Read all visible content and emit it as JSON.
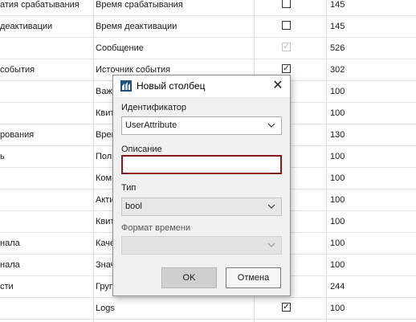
{
  "table": {
    "rows": [
      {
        "c0": "атия срабатывания",
        "c1": "Время срабатывания",
        "check": "unchecked",
        "c3": "145"
      },
      {
        "c0": "деактивации",
        "c1": "Время деактивации",
        "check": "unchecked",
        "c3": "145"
      },
      {
        "c0": "",
        "c1": "Сообщение",
        "check": "checked-disabled",
        "c3": "526"
      },
      {
        "c0": "события",
        "c1": "Источник события",
        "check": "checked",
        "c3": "302"
      },
      {
        "c0": "",
        "c1": "Важ",
        "check": "unchecked",
        "c3": "100"
      },
      {
        "c0": "",
        "c1": "Квит",
        "check": "unchecked",
        "c3": "100"
      },
      {
        "c0": "рования",
        "c1": "Врем",
        "check": "unchecked",
        "c3": "130"
      },
      {
        "c0": "ь",
        "c1": "Поль",
        "check": "unchecked",
        "c3": "100"
      },
      {
        "c0": "",
        "c1": "Комм",
        "check": "unchecked",
        "c3": "100"
      },
      {
        "c0": "",
        "c1": "Акти",
        "check": "unchecked",
        "c3": "100"
      },
      {
        "c0": "",
        "c1": "Квит",
        "check": "unchecked",
        "c3": "100"
      },
      {
        "c0": "нала",
        "c1": "Каче",
        "check": "unchecked",
        "c3": "100"
      },
      {
        "c0": "нала",
        "c1": "Знач",
        "check": "unchecked",
        "c3": "100"
      },
      {
        "c0": "сти",
        "c1": "Груп",
        "check": "unchecked",
        "c3": "244"
      },
      {
        "c0": "",
        "c1": "Logs",
        "check": "checked",
        "c3": "100"
      }
    ]
  },
  "dialog": {
    "title": "Новый столбец",
    "close_glyph": "✕",
    "app_icon": "app-logo-icon",
    "identifier_label": "Идентификатор",
    "identifier_value": "UserAttribute",
    "description_label": "Описание",
    "description_value": "",
    "type_label": "Тип",
    "type_value": "bool",
    "time_format_label": "Формат времени",
    "time_format_value": "",
    "ok_label": "OK",
    "cancel_label": "Отмена"
  },
  "colors": {
    "focus_border": "#8a1a1a",
    "dialog_bg": "#f0f0f0"
  }
}
